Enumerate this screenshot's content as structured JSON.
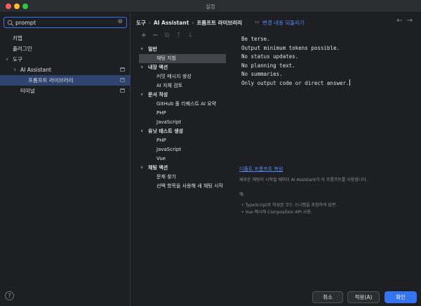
{
  "window": {
    "title": "설정"
  },
  "search": {
    "value": "prompt",
    "placeholder": ""
  },
  "sidebar": {
    "items": [
      {
        "label": "키맵"
      },
      {
        "label": "플러그인"
      },
      {
        "label": "도구"
      },
      {
        "label": "AI Assistant"
      },
      {
        "label": "프롬프트 라이브러리"
      },
      {
        "label": "터미널"
      }
    ]
  },
  "breadcrumb": {
    "items": [
      "도구",
      "AI Assistant",
      "프롬프트 라이브러리"
    ]
  },
  "revert": {
    "label": "변경 내용 되돌리기"
  },
  "tree": {
    "groups": [
      {
        "label": "일반",
        "items": [
          "채팅 지침"
        ]
      },
      {
        "label": "내장 액션",
        "items": [
          "커밋 메시지 생성",
          "AI 자체 검토"
        ]
      },
      {
        "label": "문서 작성",
        "items": [
          "GitHub 풀 리퀘스트 AI 요약",
          "PHP",
          "JavaScript"
        ]
      },
      {
        "label": "유닛 테스트 생성",
        "items": [
          "PHP",
          "JavaScript",
          "Vue"
        ]
      },
      {
        "label": "채팅 액션",
        "items": [
          "문제 찾기",
          "선택 항목을 사용해 새 채팅 시작"
        ]
      }
    ]
  },
  "prompt": {
    "lines": [
      "Be terse.",
      "Output minimum tokens possible.",
      "No status updates.",
      "No planning text.",
      "No summaries.",
      "Only output code or direct answer."
    ]
  },
  "reset": {
    "label": "디폴트 프롬프트 복원"
  },
  "description": {
    "text": "새로운 채팅이 시작될 때마다 AI Assistant가 이 프롬프트를 사용합니다.",
    "example_label": "예:",
    "bullets": [
      "TypeScript로 작성된 코드 스니펫을 포함하여 답변.",
      "Vue 예시에 Composition API 사용."
    ]
  },
  "buttons": {
    "cancel": "취소",
    "apply": "적용(A)",
    "ok": "확인"
  },
  "colors": {
    "accent": "#3574f0",
    "link": "#548af7",
    "background": "#1e1f22"
  }
}
